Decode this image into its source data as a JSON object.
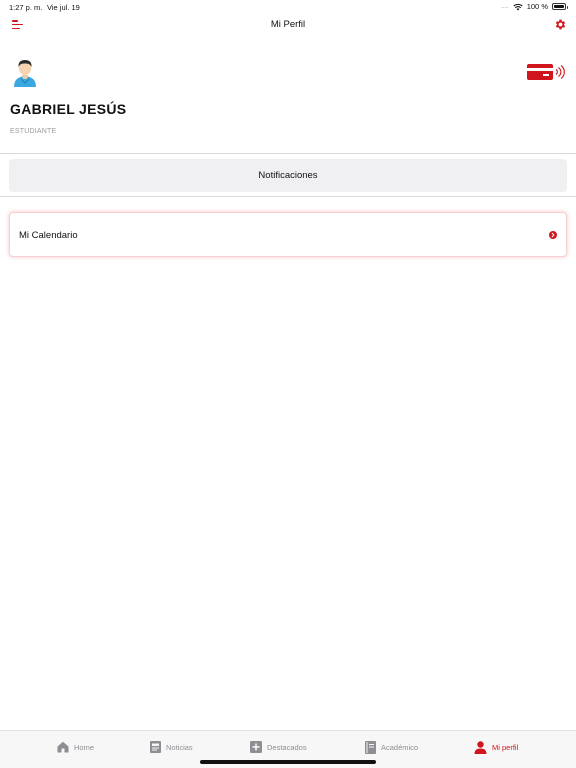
{
  "status_bar": {
    "time": "1:27 p. m.",
    "date": "Vie jul. 19",
    "signal_dots": "....",
    "battery": "100 %"
  },
  "header": {
    "title": "Mi Perfil",
    "menu_icon": "menu-icon",
    "settings_icon": "gear-icon"
  },
  "profile": {
    "name": "GABRIEL JESÚS",
    "role": "ESTUDIANTE",
    "avatar_icon": "user-avatar-icon",
    "card_icon": "contactless-card-icon"
  },
  "actions": {
    "notifications_label": "Notificaciones"
  },
  "menu": {
    "items": [
      {
        "label": "Mi Calendario",
        "icon": "chevron-right-icon"
      }
    ]
  },
  "tab_bar": {
    "tabs": [
      {
        "label": "Home",
        "icon": "home-icon",
        "active": false
      },
      {
        "label": "Noticias",
        "icon": "news-icon",
        "active": false
      },
      {
        "label": "Destacados",
        "icon": "plus-square-icon",
        "active": false
      },
      {
        "label": "Académico",
        "icon": "book-icon",
        "active": false
      },
      {
        "label": "Mi perfil",
        "icon": "user-icon",
        "active": true
      }
    ]
  },
  "colors": {
    "accent": "#d0161c",
    "inactive_tab": "#8e8e93",
    "button_bg": "#f0f0f2"
  }
}
